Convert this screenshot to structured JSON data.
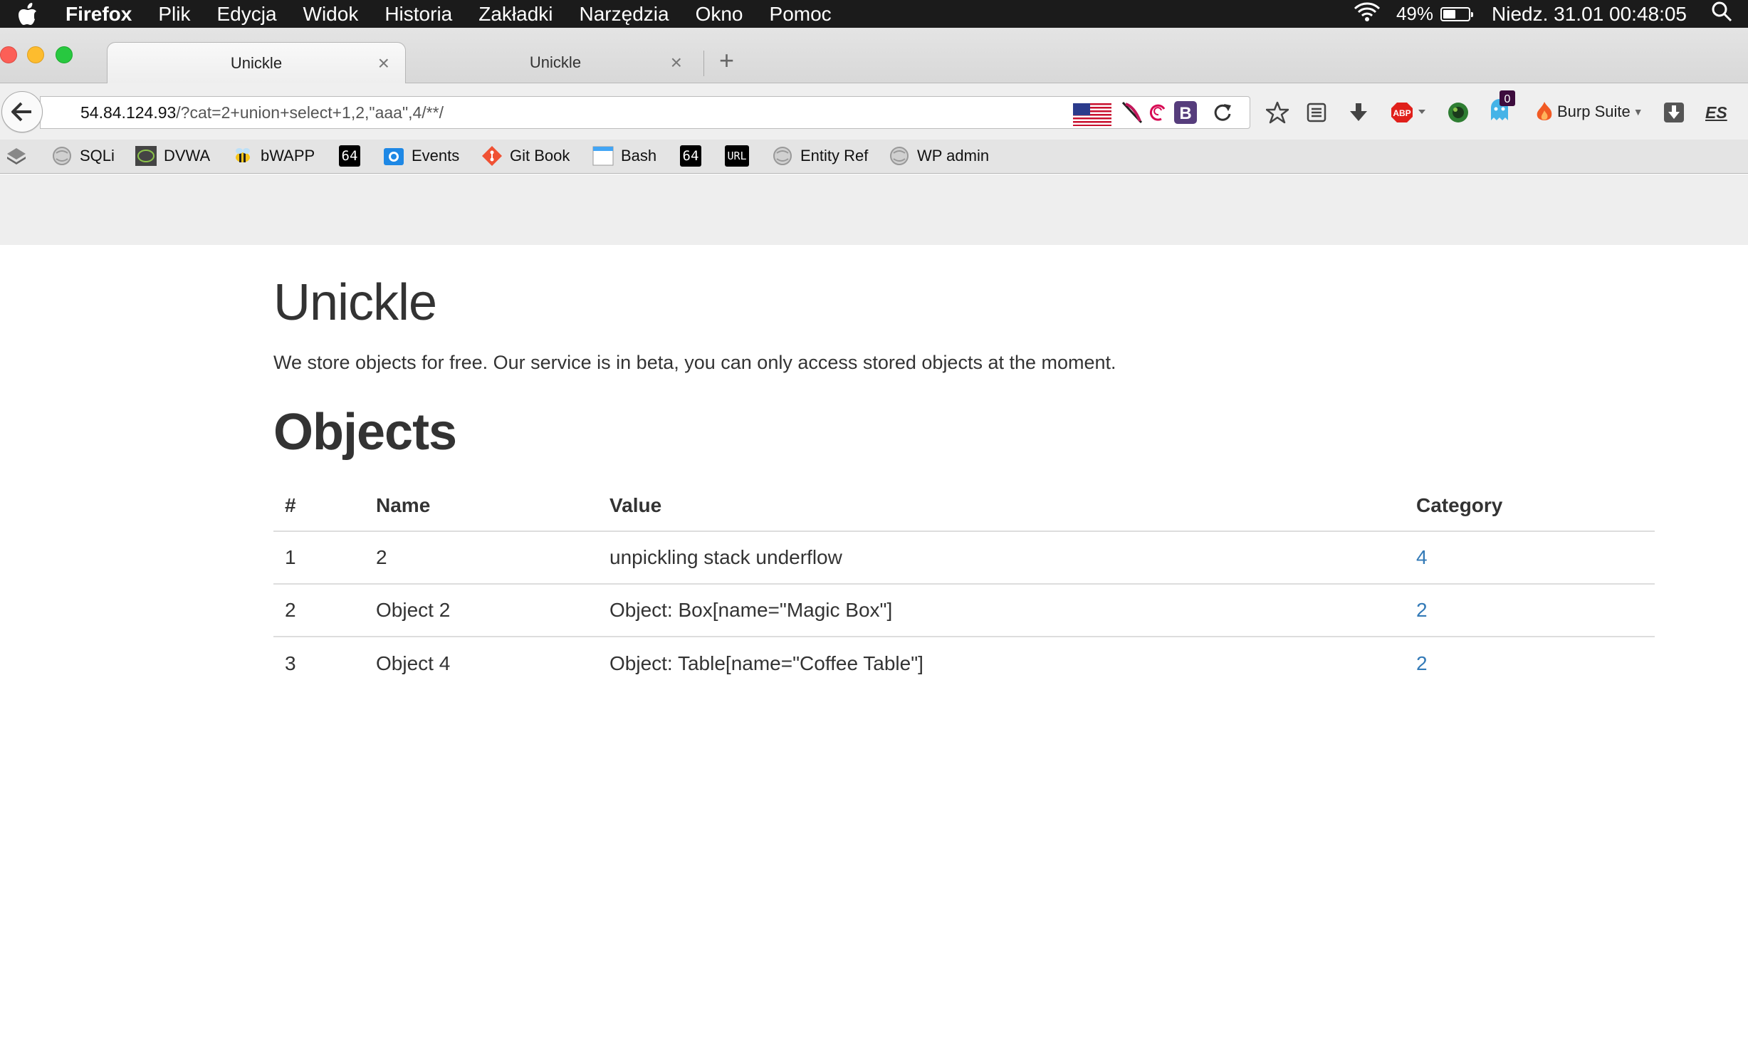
{
  "menubar": {
    "app_name": "Firefox",
    "menus": [
      "Plik",
      "Edycja",
      "Widok",
      "Historia",
      "Zakładki",
      "Narzędzia",
      "Okno",
      "Pomoc"
    ],
    "battery_percent": "49%",
    "battery_level": 0.49,
    "clock": "Niedz. 31.01  00:48:05"
  },
  "tabs": [
    {
      "label": "Unickle",
      "active": true
    },
    {
      "label": "Unickle",
      "active": false
    }
  ],
  "toolbar": {
    "url_host": "54.84.124.93",
    "url_rest": "/?cat=2+union+select+1,2,\"aaa\",4/**/",
    "burp_label": "Burp Suite",
    "notification_count": "0",
    "lang_label": "ES"
  },
  "bookmarks": [
    {
      "label": "SQLi",
      "icon": "globe-icon"
    },
    {
      "label": "DVWA",
      "icon": "dvwa-icon"
    },
    {
      "label": "bWAPP",
      "icon": "bee-icon"
    },
    {
      "label": "64",
      "icon": "base64-icon"
    },
    {
      "label": "Events",
      "icon": "events-icon"
    },
    {
      "label": "Git Book",
      "icon": "git-icon"
    },
    {
      "label": "Bash",
      "icon": "bash-icon"
    },
    {
      "label": "64",
      "icon": "base64-icon"
    },
    {
      "label": "URL",
      "icon": "url-icon"
    },
    {
      "label": "Entity Ref",
      "icon": "globe-icon"
    },
    {
      "label": "WP admin",
      "icon": "globe-icon"
    }
  ],
  "page": {
    "title": "Unickle",
    "description": "We store objects for free. Our service is in beta, you can only access stored objects at the moment.",
    "section_title": "Objects",
    "table": {
      "headers": [
        "#",
        "Name",
        "Value",
        "Category"
      ],
      "rows": [
        {
          "num": "1",
          "name": "2",
          "value": "unpickling stack underflow",
          "category": "4"
        },
        {
          "num": "2",
          "name": "Object 2",
          "value": "Object: Box[name=\"Magic Box\"]",
          "category": "2"
        },
        {
          "num": "3",
          "name": "Object 4",
          "value": "Object: Table[name=\"Coffee Table\"]",
          "category": "2"
        }
      ]
    }
  },
  "colors": {
    "link": "#337ab7",
    "menubar_bg": "#1b1b1b",
    "text": "#333333"
  }
}
